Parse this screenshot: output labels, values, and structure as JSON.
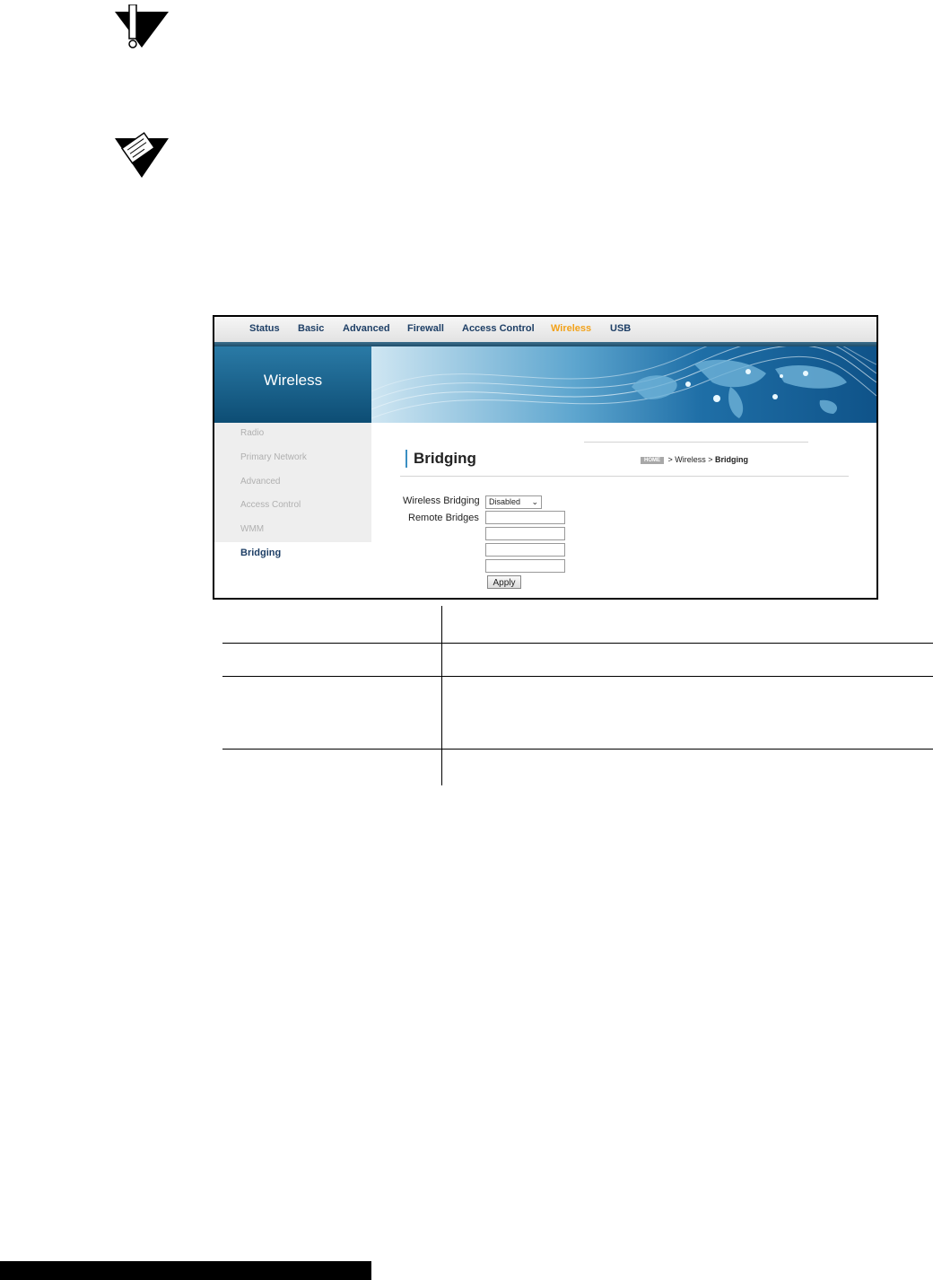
{
  "nav": {
    "items": [
      "Status",
      "Basic",
      "Advanced",
      "Firewall",
      "Access Control",
      "Wireless",
      "USB"
    ],
    "active": "Wireless"
  },
  "banner": {
    "title": "Wireless"
  },
  "sidebar": {
    "items": [
      "Radio",
      "Primary Network",
      "Advanced",
      "Access Control",
      "WMM",
      "Bridging"
    ],
    "active": "Bridging"
  },
  "content": {
    "title": "Bridging",
    "breadcrumb": {
      "home": "HOME",
      "sep1": "> Wireless >",
      "current": "Bridging"
    },
    "form": {
      "bridging_label": "Wireless Bridging",
      "bridging_value": "Disabled",
      "remote_label": "Remote Bridges",
      "remote_values": [
        "",
        "",
        "",
        ""
      ],
      "apply_label": "Apply"
    }
  },
  "colors": {
    "nav_text": "#1e3f66",
    "nav_active": "#f2a21a",
    "banner": "#0d4d74"
  }
}
